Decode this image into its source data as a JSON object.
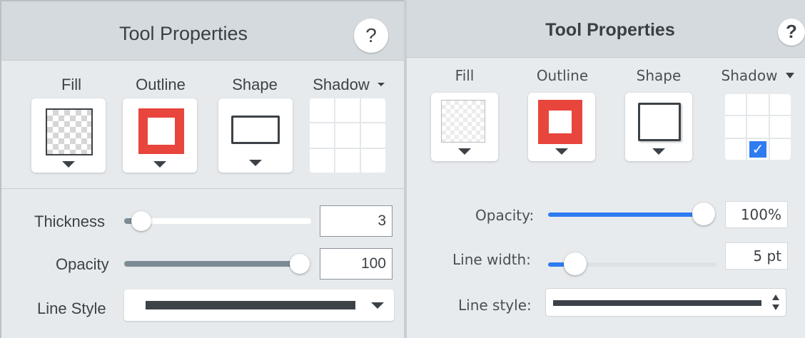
{
  "left_panel": {
    "title": "Tool Properties",
    "help_label": "?",
    "tabs": {
      "fill": "Fill",
      "outline": "Outline",
      "shape": "Shape",
      "shadow": "Shadow"
    },
    "thickness": {
      "label": "Thickness",
      "value": "3",
      "slider_fraction": 0.03
    },
    "opacity": {
      "label": "Opacity",
      "value": "100",
      "slider_fraction": 1.0
    },
    "line_style": {
      "label": "Line Style"
    }
  },
  "right_panel": {
    "title": "Tool Properties",
    "help_label": "?",
    "tabs": {
      "fill": "Fill",
      "outline": "Outline",
      "shape": "Shape",
      "shadow": "Shadow"
    },
    "opacity": {
      "label": "Opacity:",
      "value": "100%",
      "slider_fraction": 1.0
    },
    "line_width": {
      "label": "Line width:",
      "value": "5 pt",
      "slider_fraction": 0.05
    },
    "line_style": {
      "label": "Line style:"
    },
    "shadow_selected": "bottom-center"
  },
  "colors": {
    "outline_red": "#e8453c",
    "slider_blue": "#2f7bf0",
    "slider_gray": "#7c8b94",
    "check_blue": "#2f7bf0"
  },
  "icons": [
    "help-icon",
    "checkerboard-icon",
    "rectangle-icon",
    "shadow-grid-icon",
    "caret-down-icon",
    "checkmark-icon",
    "stepper-icon"
  ]
}
